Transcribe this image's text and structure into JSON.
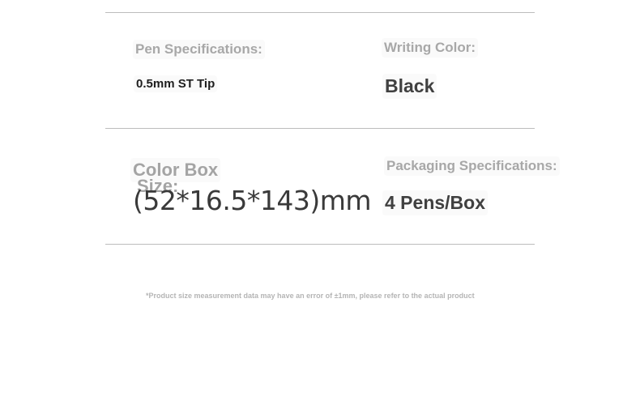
{
  "pen_specifications": {
    "label": "Pen Specifications:",
    "value": "0.5mm ST Tip"
  },
  "writing_color": {
    "label": "Writing Color:",
    "value": "Black"
  },
  "color_box_size": {
    "label_line1": "Color Box",
    "label_line2": "Size:",
    "value": "(52*16.5*143)mm"
  },
  "packaging_specifications": {
    "label": "Packaging Specifications:",
    "value": "4 Pens/Box"
  },
  "footnote": "*Product size measurement data may have an error of ±1mm, please refer to the actual product",
  "colors": {
    "label": "#a8a8a8",
    "value": "#404040",
    "divider": "#bdbdbd",
    "background": "#ffffff"
  }
}
